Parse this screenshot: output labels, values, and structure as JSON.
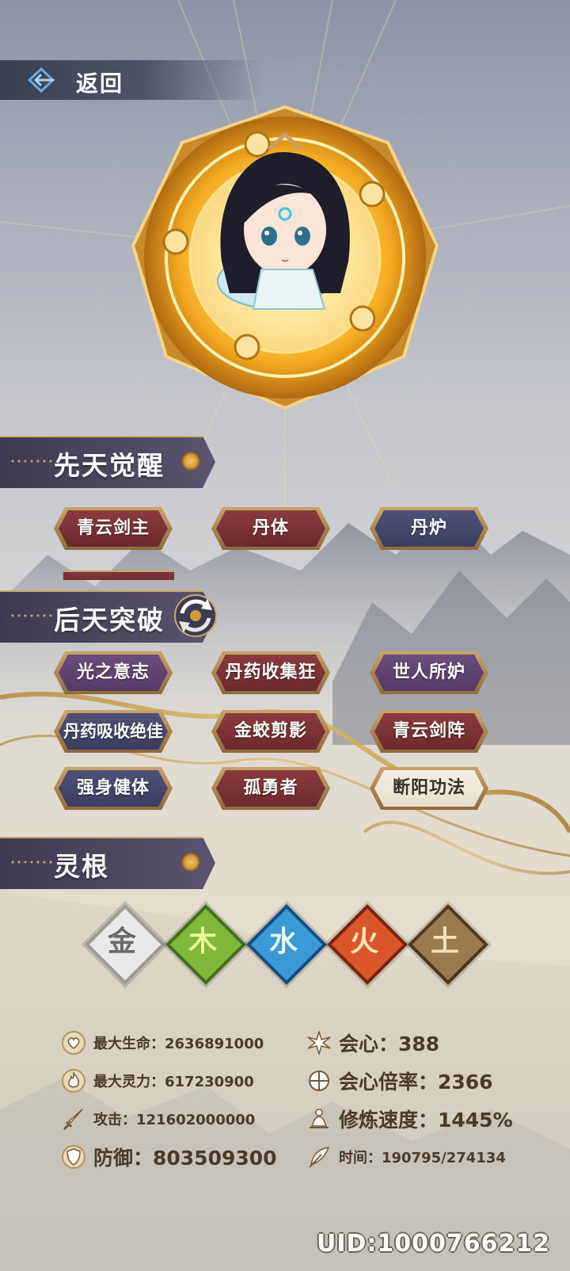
{
  "nav": {
    "back_label": "返回"
  },
  "sections": {
    "innate": "先天觉醒",
    "acquired": "后天突破",
    "spirit_root": "灵根"
  },
  "innate_traits": [
    {
      "label": "青云剑主",
      "color": "red"
    },
    {
      "label": "丹体",
      "color": "red"
    },
    {
      "label": "丹炉",
      "color": "blue"
    }
  ],
  "acquired_traits": [
    {
      "label": "光之意志",
      "color": "purple"
    },
    {
      "label": "丹药收集狂",
      "color": "red"
    },
    {
      "label": "世人所妒",
      "color": "purple"
    },
    {
      "label": "丹药吸收绝佳",
      "color": "blue"
    },
    {
      "label": "金蛟剪影",
      "color": "red"
    },
    {
      "label": "青云剑阵",
      "color": "red"
    },
    {
      "label": "强身健体",
      "color": "blue"
    },
    {
      "label": "孤勇者",
      "color": "red"
    },
    {
      "label": "断阳功法",
      "color": "cream"
    }
  ],
  "spirit_roots": [
    {
      "glyph": "金",
      "color": "#9a9a9a",
      "fill": "#efefef",
      "name": "metal-root-icon"
    },
    {
      "glyph": "木",
      "color": "#4f8a2a",
      "fill": "#a7d64f",
      "name": "wood-root-icon"
    },
    {
      "glyph": "水",
      "color": "#1e5f9a",
      "fill": "#4fb0e3",
      "name": "water-root-icon"
    },
    {
      "glyph": "火",
      "color": "#8a2a16",
      "fill": "#e9672c",
      "name": "fire-root-icon"
    },
    {
      "glyph": "土",
      "color": "#5a4228",
      "fill": "#a6845a",
      "name": "earth-root-icon"
    }
  ],
  "stats": {
    "max_hp": "最大生命：2636891000",
    "crit": "会心：388",
    "max_spirit": "最大灵力：617230900",
    "crit_rate": "会心倍率：2366",
    "attack": "攻击：121602000000",
    "cultivation_speed": "修炼速度：1445%",
    "defense": "防御：803509300",
    "time": "时间：190795/274134"
  },
  "uid": "UID:1000766212",
  "colors": {
    "gold": "#d9b36a",
    "chip_red": "#7b3135",
    "chip_blue": "#45476b",
    "chip_purple": "#5f4370",
    "stat_text": "#4a3a2a"
  }
}
